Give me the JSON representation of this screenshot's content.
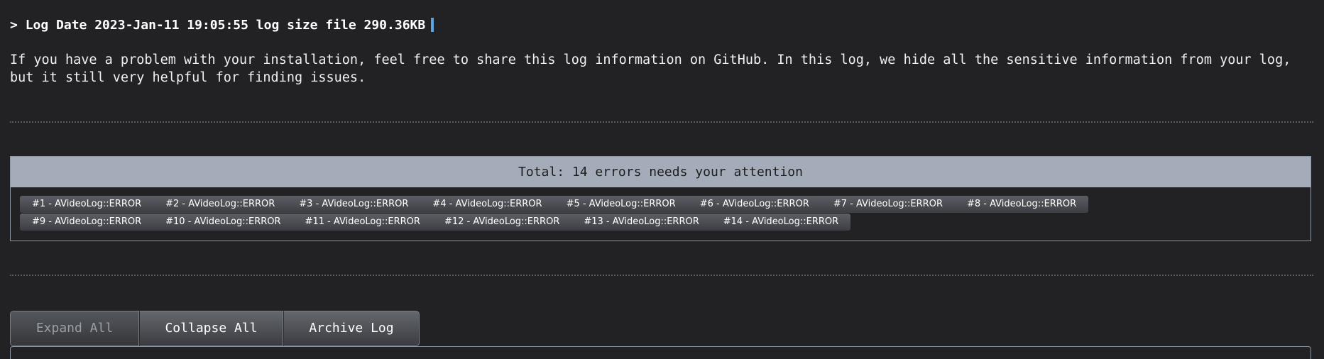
{
  "header": {
    "prompt": ">",
    "text": "Log Date 2023-Jan-11 19:05:55 log size file 290.36KB"
  },
  "intro": {
    "text": "If you have a problem with your installation, feel free to share this log information on GitHub. In this log, we hide all the sensitive information from your log, but it still very helpful for finding issues."
  },
  "errors": {
    "title": "Total: 14 errors needs your attention",
    "rows": [
      [
        "#1 - AVideoLog::ERROR",
        "#2 - AVideoLog::ERROR",
        "#3 - AVideoLog::ERROR",
        "#4 - AVideoLog::ERROR",
        "#5 - AVideoLog::ERROR",
        "#6 - AVideoLog::ERROR",
        "#7 - AVideoLog::ERROR",
        "#8 - AVideoLog::ERROR"
      ],
      [
        "#9 - AVideoLog::ERROR",
        "#10 - AVideoLog::ERROR",
        "#11 - AVideoLog::ERROR",
        "#12 - AVideoLog::ERROR",
        "#13 - AVideoLog::ERROR",
        "#14 - AVideoLog::ERROR"
      ]
    ]
  },
  "buttons": {
    "expand_all": "Expand All",
    "collapse_all": "Collapse All",
    "archive_log": "Archive Log"
  },
  "colors": {
    "background": "#222225",
    "title_bar": "#a4abb9",
    "cursor": "#5aa3e0"
  }
}
